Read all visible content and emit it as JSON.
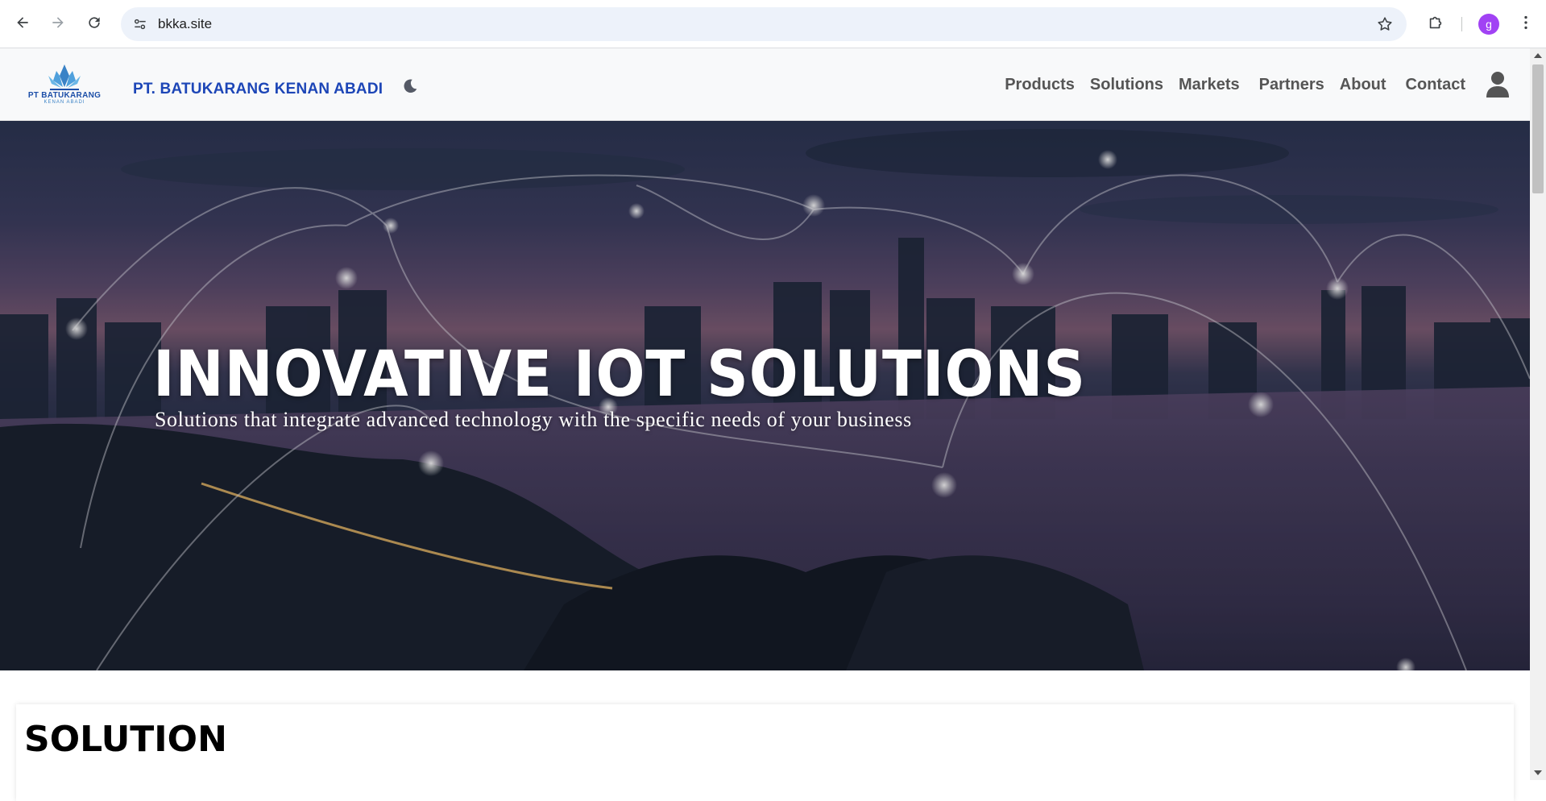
{
  "browser": {
    "url": "bkka.site",
    "profile_initial": "g",
    "icons": {
      "back": "arrow-left-icon",
      "forward": "arrow-right-icon",
      "reload": "reload-icon",
      "site_info": "tune-icon",
      "bookmark": "star-icon",
      "extensions": "puzzle-icon",
      "menu": "kebab-menu-icon"
    }
  },
  "header": {
    "logo_text": "PT BATUKARANG",
    "logo_subtext": "KENAN ABADI",
    "company_name": "PT. BATUKARANG KENAN ABADI",
    "nav": [
      {
        "label": "Products"
      },
      {
        "label": "Solutions"
      },
      {
        "label": "Markets"
      },
      {
        "label": "Partners"
      },
      {
        "label": "About"
      },
      {
        "label": "Contact"
      }
    ]
  },
  "hero": {
    "title": "INNOVATIVE IOT SOLUTIONS",
    "subtitle": "Solutions that integrate advanced technology with the specific needs of your business"
  },
  "solution": {
    "title": "SOLUTION"
  },
  "colors": {
    "brand_blue": "#1d46b7",
    "nav_text": "#555555",
    "profile": "#a142f4"
  }
}
